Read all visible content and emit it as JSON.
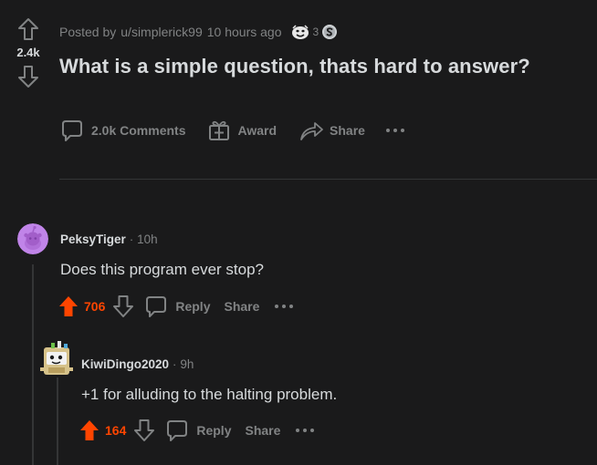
{
  "post": {
    "vote_count": "2.4k",
    "meta_prefix": "Posted by",
    "author": "u/simplerick99",
    "time": "10 hours ago",
    "award_count": "3",
    "title": "What is a simple question, thats hard to answer?",
    "actions": {
      "comments": "2.0k Comments",
      "award": "Award",
      "share": "Share"
    }
  },
  "comments": [
    {
      "author": "PeksyTiger",
      "separator": "·",
      "time": "10h",
      "body": "Does this program ever stop?",
      "score": "706",
      "reply": "Reply",
      "share": "Share"
    },
    {
      "author": "KiwiDingo2020",
      "separator": "·",
      "time": "9h",
      "body": "+1 for alluding to the halting problem.",
      "score": "164",
      "reply": "Reply",
      "share": "Share"
    }
  ],
  "colors": {
    "background": "#1a1a1b",
    "text": "#d7dadc",
    "muted": "#818384",
    "upvote": "#ff4500",
    "avatar_bg": "#c084e8"
  },
  "icons": {
    "upvote": "arrow-up-icon",
    "downvote": "arrow-down-icon",
    "comments": "speech-bubble-icon",
    "award": "gift-icon",
    "share": "share-arrow-icon",
    "more": "ellipsis-icon"
  }
}
